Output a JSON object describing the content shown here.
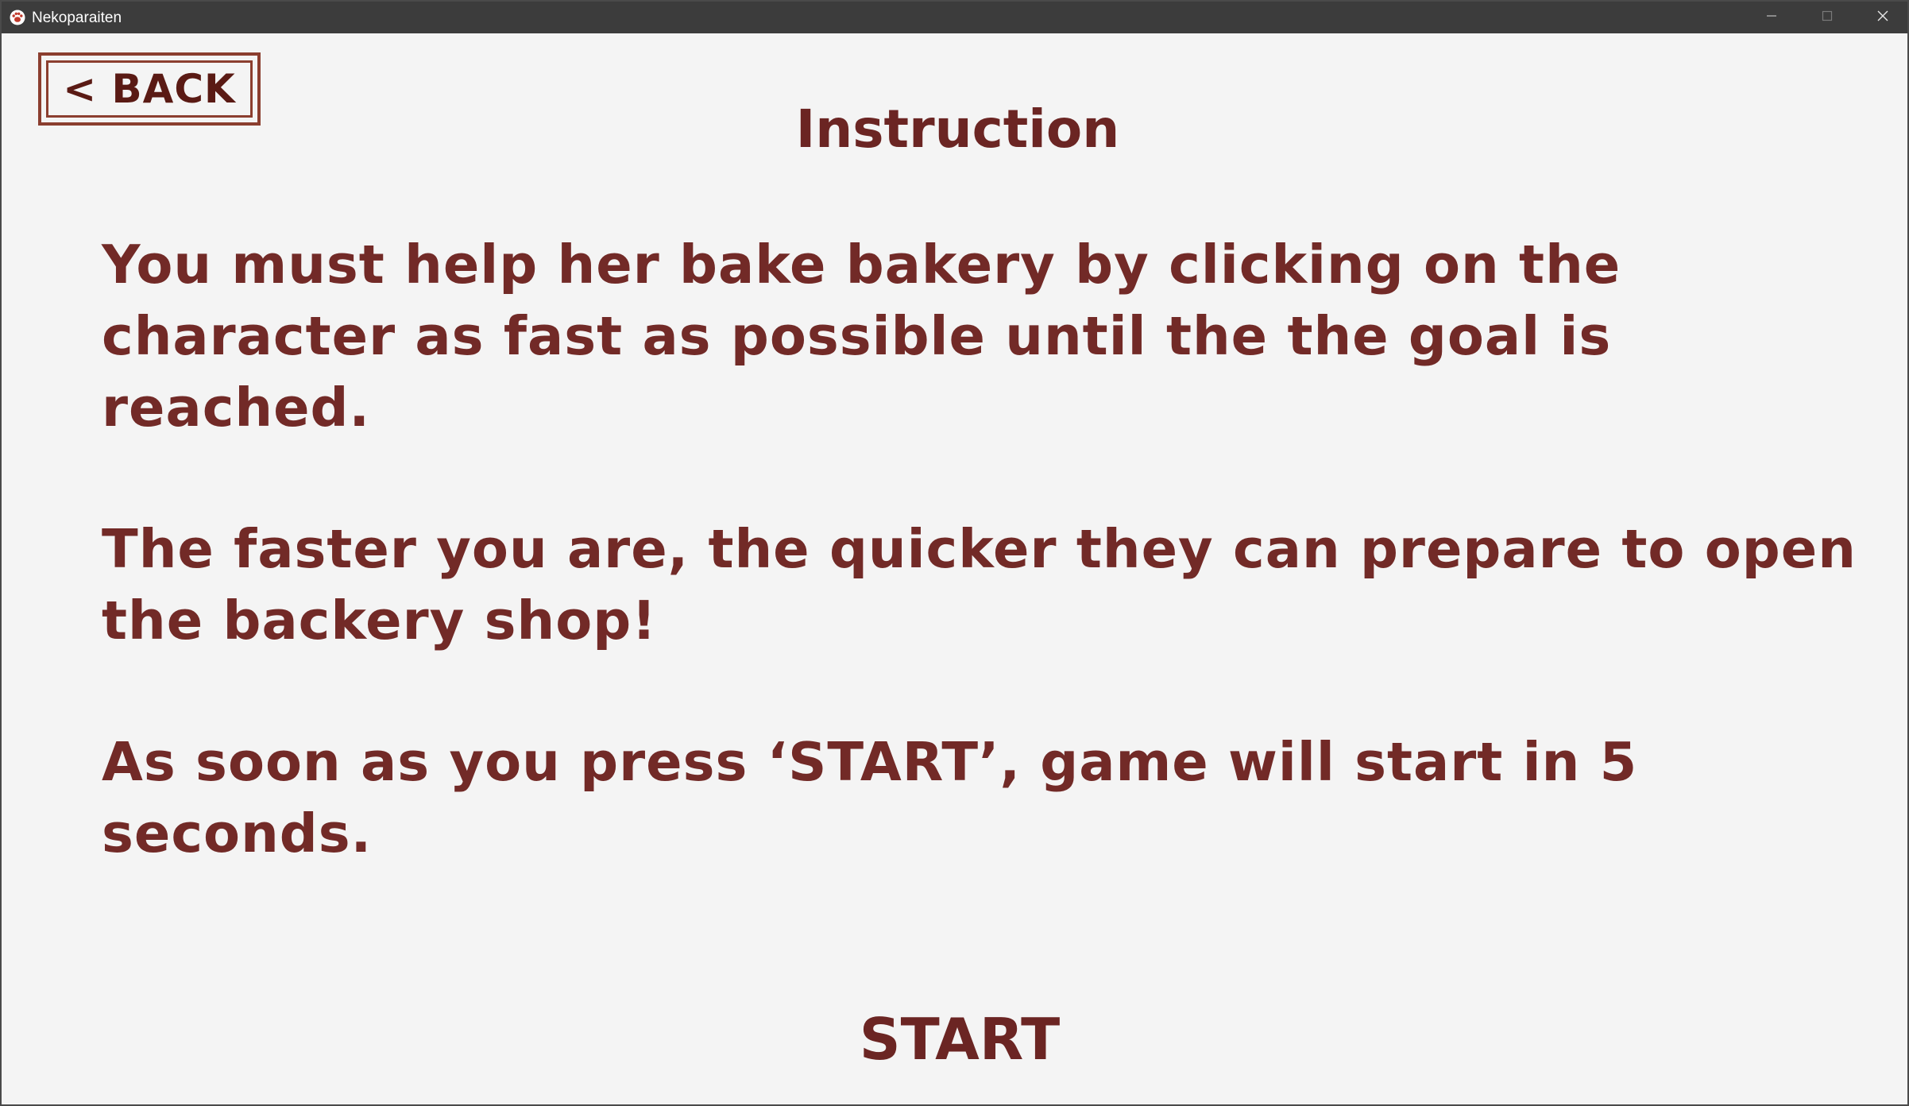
{
  "window": {
    "title": "Nekoparaiten",
    "app_icon": "paw-icon",
    "controls": {
      "minimize_icon": "minimize-icon",
      "maximize_icon": "maximize-icon",
      "close_icon": "close-icon"
    }
  },
  "screen": {
    "back_label": "< BACK",
    "title": "Instruction",
    "paragraphs": [
      "You must help her bake bakery by clicking on the character as fast as possible until the the goal is reached.",
      "The faster you are, the quicker they can prepare to open the backery shop!",
      "As soon as you press ‘START’, game will start in 5 seconds."
    ],
    "start_label": "START"
  },
  "colors": {
    "text": "#722a27",
    "button_border": "#8b3e2f",
    "background": "#f4f4f4",
    "titlebar": "#3c3c3c"
  }
}
